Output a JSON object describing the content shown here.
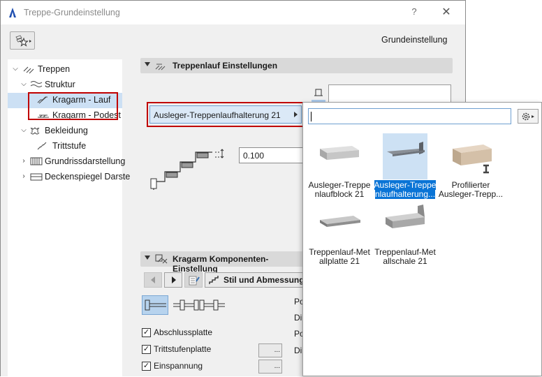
{
  "window": {
    "title": "Treppe-Grundeinstellung",
    "help_label": "?",
    "close_label": "✕"
  },
  "header": {
    "right_label": "Grundeinstellung"
  },
  "tree": {
    "items": [
      {
        "label": "Treppen",
        "expanded": true,
        "icon": "stairs-icon"
      },
      {
        "label": "Struktur",
        "expanded": true,
        "icon": "structure-icon"
      },
      {
        "label": "Kragarm - Lauf",
        "selected": true,
        "icon": "cantilever-flight-icon"
      },
      {
        "label": "Kragarm - Podest",
        "icon": "cantilever-landing-icon"
      },
      {
        "label": "Bekleidung",
        "expanded": true,
        "icon": "finish-icon"
      },
      {
        "label": "Trittstufe",
        "icon": "tread-icon"
      },
      {
        "label": "Grundrissdarstellung",
        "expanded": false,
        "icon": "floor-plan-icon"
      },
      {
        "label": "Deckenspiegel Darste",
        "expanded": false,
        "icon": "ceiling-plan-icon"
      }
    ]
  },
  "section1": {
    "title": "Treppenlauf Einstellungen",
    "selector_value": "Ausleger-Treppenlaufhalterung 21",
    "thickness_value": "0.100"
  },
  "section2": {
    "title": "Kragarm Komponenten-Einstellung",
    "style_label": "Stil und Abmessunger",
    "checkboxes": [
      {
        "label": "Abschlussplatte",
        "checked": true
      },
      {
        "label": "Trittstufenplatte",
        "checked": true
      },
      {
        "label": "Einspannung",
        "checked": true
      }
    ],
    "mini_button_label": "...",
    "truncated_labels": [
      "Po",
      "Di",
      "Po",
      "Di"
    ]
  },
  "popup": {
    "search_value": "",
    "tiles": [
      {
        "line1": "Ausleger-Treppe",
        "line2": "nlaufblock 21",
        "selected": false
      },
      {
        "line1": "Ausleger-Treppe",
        "line2": "nlaufhalterung...",
        "selected": true
      },
      {
        "line1": "Profilierter",
        "line2": "Ausleger-Trepp...",
        "selected": false
      },
      {
        "line1": "Treppenlauf-Met",
        "line2": "allplatte 21",
        "selected": false
      },
      {
        "line1": "Treppenlauf-Met",
        "line2": "allschale 21",
        "selected": false
      }
    ]
  },
  "colors": {
    "highlight_red": "#c00000",
    "selection_blue": "#0a74d6",
    "tree_selection": "#cce0f4"
  }
}
